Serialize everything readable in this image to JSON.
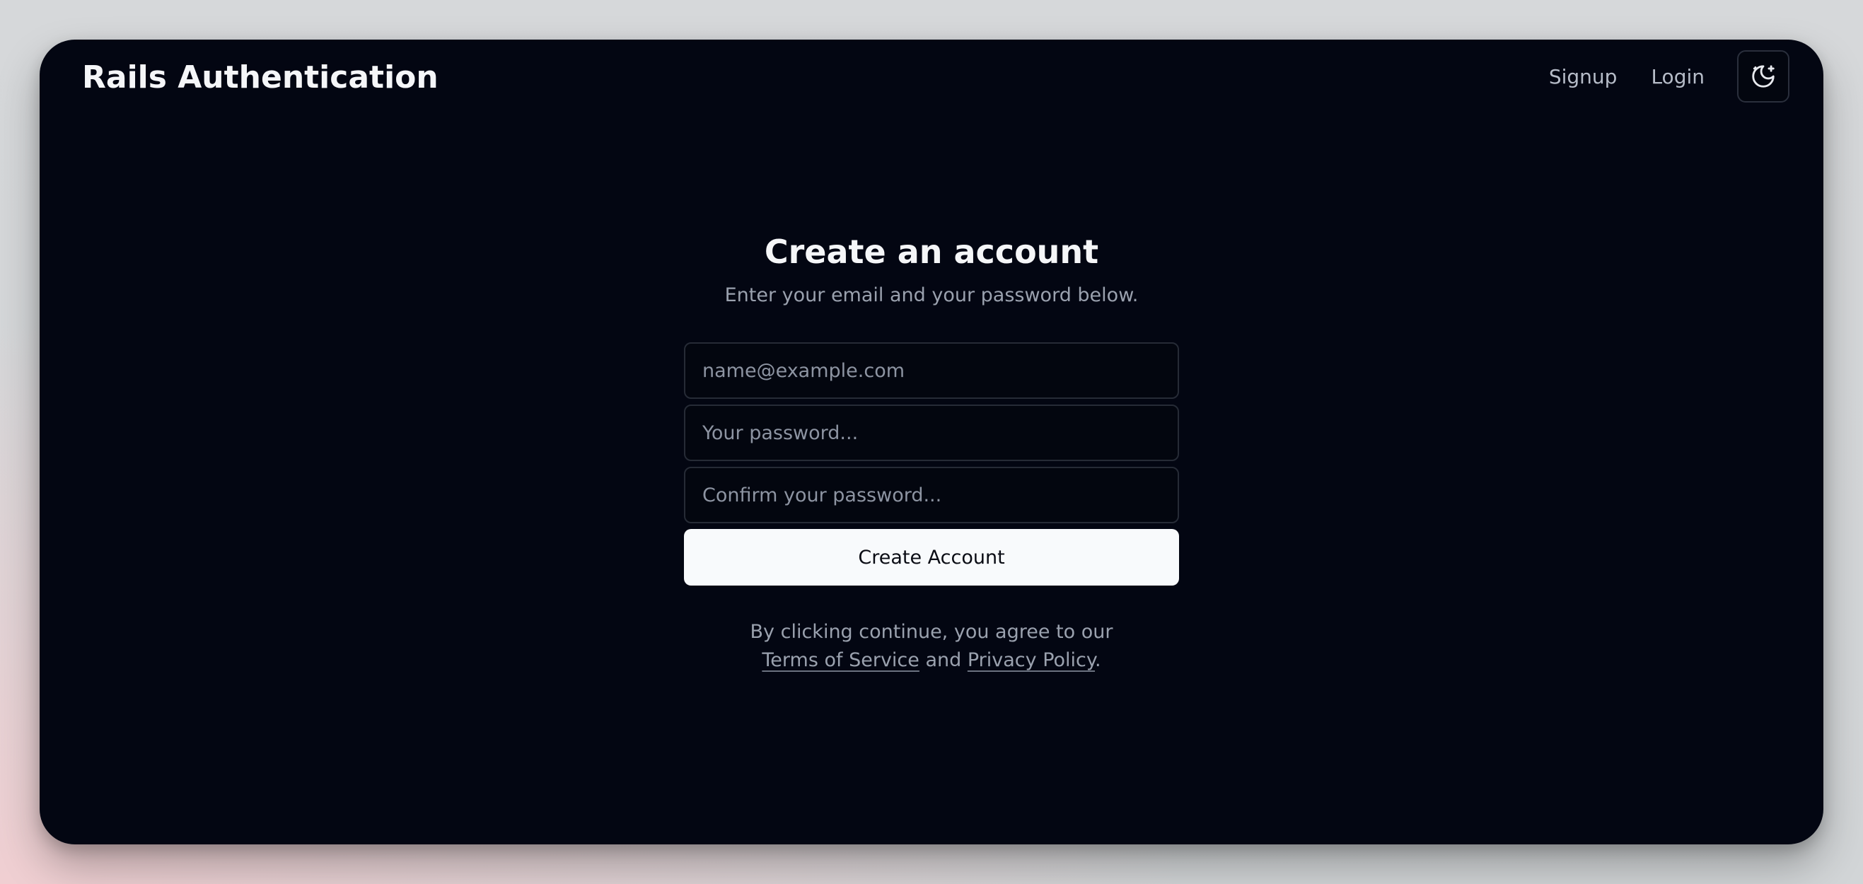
{
  "app": {
    "brand": "Rails Authentication"
  },
  "nav": {
    "signup_label": "Signup",
    "login_label": "Login",
    "theme_icon": "moon-stars-icon"
  },
  "form": {
    "title": "Create an account",
    "subtitle": "Enter your email and your password below.",
    "email_placeholder": "name@example.com",
    "email_value": "",
    "password_placeholder": "Your password...",
    "password_value": "",
    "confirm_placeholder": "Confirm your password...",
    "confirm_value": "",
    "submit_label": "Create Account"
  },
  "legal": {
    "prefix": "By clicking continue, you agree to our ",
    "terms_label": "Terms of Service",
    "and_text": " and ",
    "privacy_label": "Privacy Policy",
    "suffix": "."
  },
  "colors": {
    "window_bg": "#030612",
    "button_bg": "#f8fafc",
    "muted_text": "#9aa1ae"
  }
}
